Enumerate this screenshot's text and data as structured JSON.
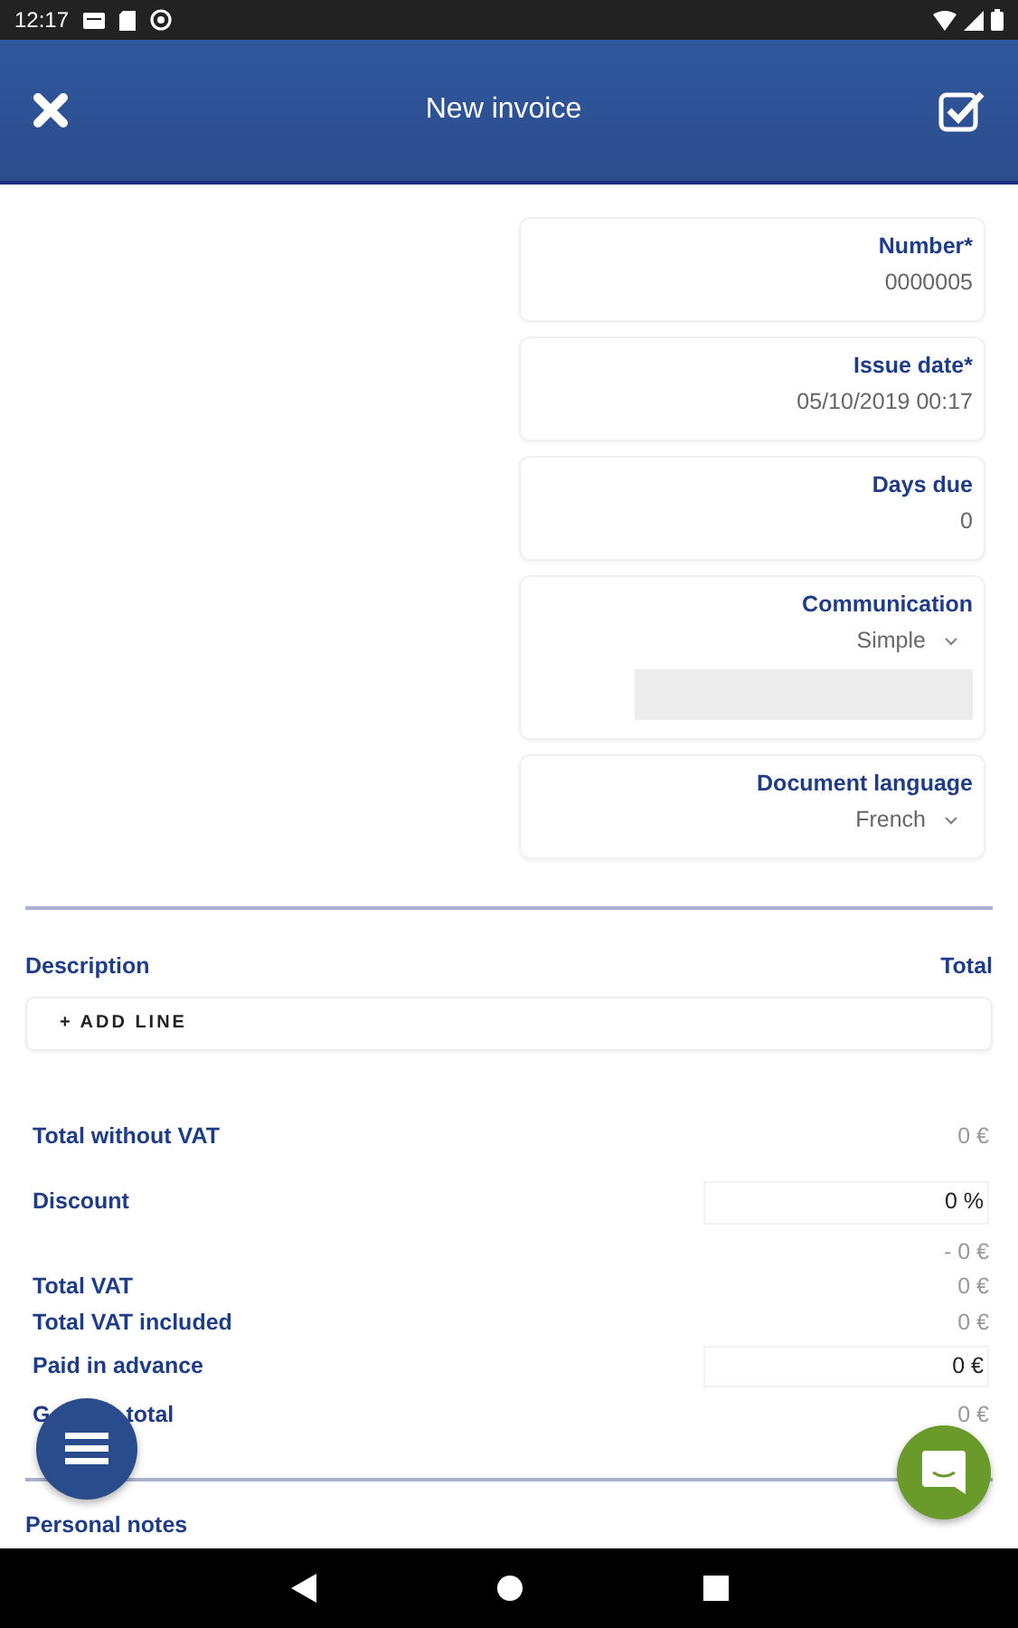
{
  "status_bar": {
    "time": "12:17"
  },
  "header": {
    "title": "New invoice"
  },
  "fields": [
    {
      "label": "Number*",
      "value": "0000005",
      "kind": "text"
    },
    {
      "label": "Issue date*",
      "value": "05/10/2019 00:17",
      "kind": "text"
    },
    {
      "label": "Days due",
      "value": "0",
      "kind": "text"
    },
    {
      "label": "Communication",
      "value": "Simple",
      "kind": "select-input"
    },
    {
      "label": "Document language",
      "value": "French",
      "kind": "select"
    }
  ],
  "lines": {
    "columns": [
      "Description",
      "Total"
    ],
    "add_button": "+ ADD LINE"
  },
  "totals": [
    {
      "label": "Total without VAT",
      "value": "0 €",
      "kind": "plain"
    },
    {
      "label": "Discount",
      "value": "0 %",
      "kind": "input"
    },
    {
      "value": "- 0 €",
      "kind": "plain"
    },
    {
      "label": "Total VAT",
      "value": "0 €",
      "kind": "tight"
    },
    {
      "label": "Total VAT included",
      "value": "0 €",
      "kind": "tight"
    },
    {
      "label": "Paid in advance",
      "value": "0 €",
      "kind": "input"
    },
    {
      "label": "G",
      "label_end": "total",
      "value": "0 €",
      "kind": "covered"
    }
  ],
  "notes": {
    "label": "Personal notes"
  }
}
